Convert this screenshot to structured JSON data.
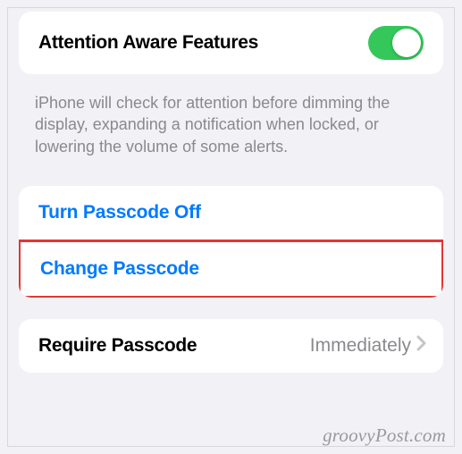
{
  "attention": {
    "title": "Attention Aware Features",
    "toggle_on": true,
    "description": "iPhone will check for attention before dimming the display, expanding a notification when locked, or lowering the volume of some alerts."
  },
  "passcode_actions": {
    "turn_off": "Turn Passcode Off",
    "change": "Change Passcode"
  },
  "require_passcode": {
    "label": "Require Passcode",
    "value": "Immediately"
  },
  "watermark": "groovyPost.com"
}
